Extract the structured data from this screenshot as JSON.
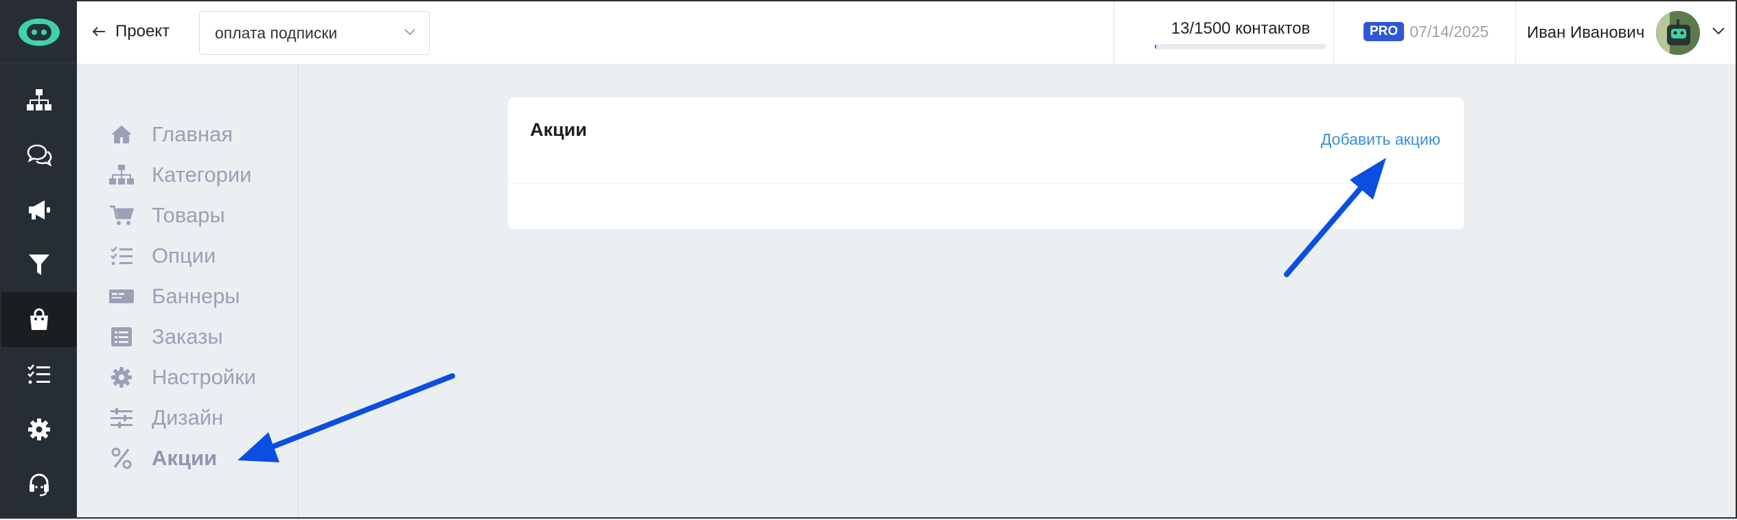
{
  "header": {
    "back_label": "Проект",
    "project_select_value": "оплата подписки",
    "contacts_text": "13/1500 контактов",
    "contacts_used": 13,
    "contacts_limit": 1500,
    "plan_badge": "PRO",
    "plan_date": "07/14/2025",
    "user_name": "Иван Иванович"
  },
  "rail": {
    "items": [
      "sitemap-icon",
      "chat-icon",
      "megaphone-icon",
      "filter-icon",
      "shop-bag-icon",
      "checklist-icon",
      "gear-icon",
      "support-icon"
    ],
    "active_index": 4
  },
  "subnav": {
    "items": [
      {
        "label": "Главная",
        "icon": "home-icon"
      },
      {
        "label": "Категории",
        "icon": "sitemap-icon"
      },
      {
        "label": "Товары",
        "icon": "cart-icon"
      },
      {
        "label": "Опции",
        "icon": "checklist-icon"
      },
      {
        "label": "Баннеры",
        "icon": "banner-icon"
      },
      {
        "label": "Заказы",
        "icon": "list-icon"
      },
      {
        "label": "Настройки",
        "icon": "gear-icon"
      },
      {
        "label": "Дизайн",
        "icon": "sliders-icon"
      },
      {
        "label": "Акции",
        "icon": "percent-icon"
      }
    ],
    "active_index": 8
  },
  "main": {
    "title": "Акции",
    "add_label": "Добавить акцию"
  },
  "colors": {
    "accent": "#2f57d6",
    "link": "#3a8ed8",
    "rail_bg": "#272d35",
    "annotation_arrow": "#0b4fe0"
  }
}
